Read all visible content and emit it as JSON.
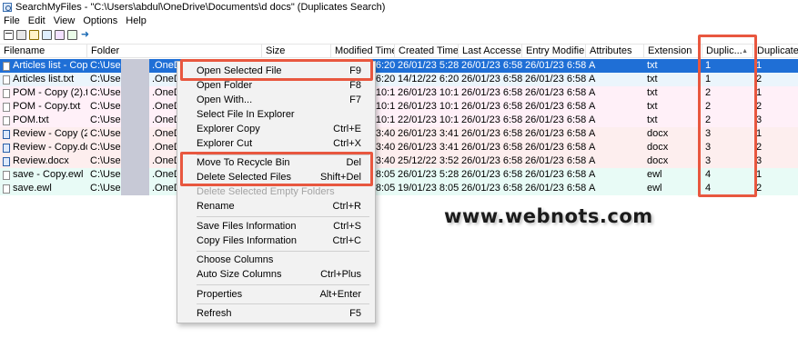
{
  "window": {
    "title": "SearchMyFiles - \"C:\\Users\\abdul\\OneDrive\\Documents\\d docs\" (Duplicates Search)"
  },
  "menu": [
    "File",
    "Edit",
    "View",
    "Options",
    "Help"
  ],
  "toolbar": {
    "icons": [
      "new-search-icon",
      "save-icon",
      "export-icon",
      "copy-icon",
      "properties-icon",
      "find-icon",
      "exit-icon"
    ]
  },
  "columns": [
    {
      "label": "Filename"
    },
    {
      "label": "Folder"
    },
    {
      "label": "Size"
    },
    {
      "label": "Modified Time"
    },
    {
      "label": "Created Time"
    },
    {
      "label": "Last Accessed..."
    },
    {
      "label": "Entry Modifie..."
    },
    {
      "label": "Attributes"
    },
    {
      "label": "Extension"
    },
    {
      "label": "Duplic..."
    },
    {
      "label": "Duplicate ..."
    }
  ],
  "rows": [
    {
      "filename": "Articles list - Copy....",
      "folder": "C:\\Users\\",
      "folder2": ".OneDriv",
      "modified": "26/01/23 6:20...",
      "created": "26/01/23 5:28...",
      "accessed": "26/01/23 6:58...",
      "entry": "26/01/23 6:58...",
      "attr": "A",
      "ext": "txt",
      "dup": "1",
      "dup2": "1",
      "bg": "#1f6fd6",
      "fg": "#ffffff",
      "icon": "text-file-icon"
    },
    {
      "filename": "Articles list.txt",
      "folder": "C:\\Users\\",
      "folder2": ".OneDriv",
      "modified": "14/12/22 6:20...",
      "created": "14/12/22 6:20...",
      "accessed": "26/01/23 6:58...",
      "entry": "26/01/23 6:58...",
      "attr": "A",
      "ext": "txt",
      "dup": "1",
      "dup2": "2",
      "bg": "#ebf5fc",
      "fg": "#000000",
      "icon": "text-file-icon"
    },
    {
      "filename": "POM - Copy (2).txt",
      "folder": "C:\\Users\\",
      "folder2": ".OneDriv",
      "modified": "22/01/23 10:1...",
      "created": "26/01/23 10:1...",
      "accessed": "26/01/23 6:58...",
      "entry": "26/01/23 6:58...",
      "attr": "A",
      "ext": "txt",
      "dup": "2",
      "dup2": "1",
      "bg": "#fff0f8",
      "fg": "#000000",
      "icon": "text-file-icon"
    },
    {
      "filename": "POM - Copy.txt",
      "folder": "C:\\Users\\",
      "folder2": ".OneDriv",
      "modified": "22/01/23 10:1...",
      "created": "26/01/23 10:1...",
      "accessed": "26/01/23 6:58...",
      "entry": "26/01/23 6:58...",
      "attr": "A",
      "ext": "txt",
      "dup": "2",
      "dup2": "2",
      "bg": "#fff0f8",
      "fg": "#000000",
      "icon": "text-file-icon"
    },
    {
      "filename": "POM.txt",
      "folder": "C:\\Users\\",
      "folder2": ".OneDriv",
      "modified": "22/01/23 10:1...",
      "created": "22/01/23 10:1...",
      "accessed": "26/01/23 6:58...",
      "entry": "26/01/23 6:58...",
      "attr": "A",
      "ext": "txt",
      "dup": "2",
      "dup2": "3",
      "bg": "#fff0f8",
      "fg": "#000000",
      "icon": "text-file-icon"
    },
    {
      "filename": "Review - Copy (2)....",
      "folder": "C:\\Users\\",
      "folder2": ".OneDriv",
      "modified": "25/12/22 3:40...",
      "created": "26/01/23 3:41...",
      "accessed": "26/01/23 6:58...",
      "entry": "26/01/23 6:58...",
      "attr": "A",
      "ext": "docx",
      "dup": "3",
      "dup2": "1",
      "bg": "#fdeeee",
      "fg": "#000000",
      "icon": "word-doc-icon"
    },
    {
      "filename": "Review - Copy.docx",
      "folder": "C:\\Users\\",
      "folder2": ".OneDriv",
      "modified": "25/12/22 3:40...",
      "created": "26/01/23 3:41...",
      "accessed": "26/01/23 6:58...",
      "entry": "26/01/23 6:58...",
      "attr": "A",
      "ext": "docx",
      "dup": "3",
      "dup2": "2",
      "bg": "#fdeeee",
      "fg": "#000000",
      "icon": "word-doc-icon"
    },
    {
      "filename": "Review.docx",
      "folder": "C:\\Users\\",
      "folder2": ".OneDriv",
      "modified": "25/12/22 3:40...",
      "created": "25/12/22 3:52...",
      "accessed": "26/01/23 6:58...",
      "entry": "26/01/23 6:58...",
      "attr": "A",
      "ext": "docx",
      "dup": "3",
      "dup2": "3",
      "bg": "#fdeeee",
      "fg": "#000000",
      "icon": "word-doc-icon"
    },
    {
      "filename": "save - Copy.ewl",
      "folder": "C:\\Users\\",
      "folder2": ".OneDriv",
      "modified": "19/01/23 8:05...",
      "created": "26/01/23 5:28...",
      "accessed": "26/01/23 6:58...",
      "entry": "26/01/23 6:58...",
      "attr": "A",
      "ext": "ewl",
      "dup": "4",
      "dup2": "1",
      "bg": "#e8fbf6",
      "fg": "#000000",
      "icon": "file-icon"
    },
    {
      "filename": "save.ewl",
      "folder": "C:\\Users\\",
      "folder2": ".OneDriv",
      "modified": "19/01/23 8:05...",
      "created": "19/01/23 8:05...",
      "accessed": "26/01/23 6:58...",
      "entry": "26/01/23 6:58...",
      "attr": "A",
      "ext": "ewl",
      "dup": "4",
      "dup2": "2",
      "bg": "#e8fbf6",
      "fg": "#000000",
      "icon": "file-icon"
    }
  ],
  "context_menu": [
    {
      "label": "Open Selected File",
      "shortcut": "F9",
      "disabled": false
    },
    {
      "label": "Open Folder",
      "shortcut": "F8",
      "disabled": false
    },
    {
      "label": "Open With...",
      "shortcut": "F7",
      "disabled": false
    },
    {
      "label": "Select File In Explorer",
      "shortcut": "",
      "disabled": false
    },
    {
      "label": "Explorer Copy",
      "shortcut": "Ctrl+E",
      "disabled": false
    },
    {
      "label": "Explorer Cut",
      "shortcut": "Ctrl+X",
      "disabled": false
    },
    {
      "label": "Move To Recycle Bin",
      "shortcut": "Del",
      "disabled": false
    },
    {
      "label": "Delete Selected Files",
      "shortcut": "Shift+Del",
      "disabled": false
    },
    {
      "label": "Delete Selected Empty Folders",
      "shortcut": "",
      "disabled": true
    },
    {
      "label": "Rename",
      "shortcut": "Ctrl+R",
      "disabled": false
    },
    {
      "label": "Save Files Information",
      "shortcut": "Ctrl+S",
      "disabled": false
    },
    {
      "label": "Copy Files Information",
      "shortcut": "Ctrl+C",
      "disabled": false
    },
    {
      "label": "Choose Columns",
      "shortcut": "",
      "disabled": false
    },
    {
      "label": "Auto Size Columns",
      "shortcut": "Ctrl+Plus",
      "disabled": false
    },
    {
      "label": "Properties",
      "shortcut": "Alt+Enter",
      "disabled": false
    },
    {
      "label": "Refresh",
      "shortcut": "F5",
      "disabled": false
    }
  ],
  "watermark": "www.webnots.com",
  "colors": {
    "selection": "#1f6fd6",
    "highlight_box": "#e8573f"
  }
}
